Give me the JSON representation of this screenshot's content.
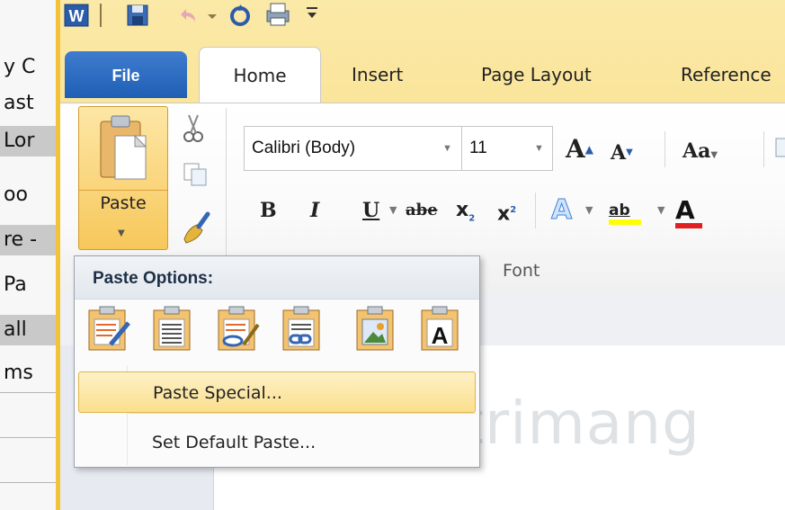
{
  "left_strip": {
    "rows": [
      "y C",
      "ast",
      "Lor",
      "oo",
      "re -",
      "Pa",
      "all",
      "ms"
    ]
  },
  "tabs": {
    "file": "File",
    "home": "Home",
    "insert": "Insert",
    "page_layout": "Page Layout",
    "references": "Reference"
  },
  "clipboard": {
    "paste_label": "Paste"
  },
  "font": {
    "font_name": "Calibri (Body)",
    "font_size": "11",
    "group_label": "Font",
    "grow_label": "A",
    "shrink_label": "A",
    "case_label": "Aa",
    "bold": "B",
    "italic": "I",
    "underline": "U",
    "strike": "abe",
    "subscript": "x",
    "superscript": "x",
    "effects_label": "A",
    "highlight_label": "ab",
    "color_label": "A"
  },
  "paste_menu": {
    "title": "Paste Options:",
    "items": [
      "Paste Special...",
      "Set Default Paste..."
    ],
    "options": [
      "keep-source-formatting",
      "merge-formatting",
      "use-destination-styles",
      "link-and-keep-source",
      "picture",
      "keep-text-only"
    ],
    "text_only_glyph": "A"
  },
  "watermark": "uantrimang",
  "colors": {
    "word_frame": "#f2c23a",
    "file_tab": "#2b6cc4",
    "highlight": "#fbdf8d",
    "font_color_bar": "#e02020"
  }
}
